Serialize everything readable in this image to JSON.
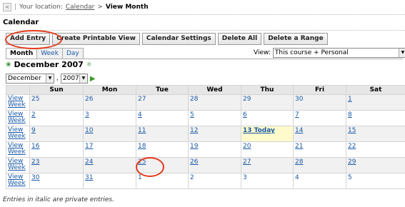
{
  "breadcrumb": {
    "back_glyph": "<",
    "location_label": "Your location:",
    "calendar_link": "Calendar",
    "separator": ">",
    "current": "View Month"
  },
  "page_title": "Calendar",
  "buttons": {
    "add_entry": "Add Entry",
    "printable": "Create Printable View",
    "settings": "Calendar Settings",
    "delete_all": "Delete All",
    "delete_range": "Delete a Range"
  },
  "tabs": {
    "month": "Month",
    "week": "Week",
    "day": "Day"
  },
  "view_selector": {
    "label": "View:",
    "value": "This course + Personal"
  },
  "month_title": "December 2007",
  "month_select": {
    "month": "December",
    "year": "2007",
    "comma": ","
  },
  "weekdays": [
    "Sun",
    "Mon",
    "Tue",
    "Wed",
    "Thu",
    "Fri",
    "Sat"
  ],
  "view_week_label": "View Week",
  "weeks": [
    [
      "25",
      "26",
      "27",
      "28",
      "29",
      "30",
      "1"
    ],
    [
      "2",
      "3",
      "4",
      "5",
      "6",
      "7",
      "8"
    ],
    [
      "9",
      "10",
      "11",
      "12",
      "13 Today",
      "14",
      "15"
    ],
    [
      "16",
      "17",
      "18",
      "19",
      "20",
      "21",
      "22"
    ],
    [
      "23",
      "24",
      "25",
      "26",
      "27",
      "28",
      "29"
    ],
    [
      "30",
      "31",
      "1",
      "2",
      "3",
      "4",
      "5"
    ]
  ],
  "footer_note": "Entries in italic are private entries.",
  "colors": {
    "link": "#1a5aa8",
    "today_bg": "#fffacc",
    "annotation": "#e23a1b"
  }
}
